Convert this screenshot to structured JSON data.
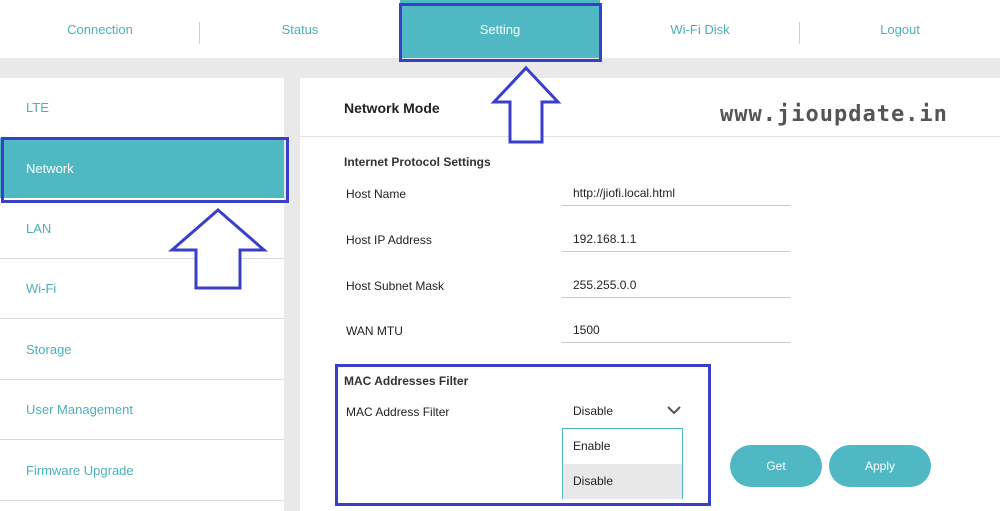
{
  "top_nav": {
    "tabs": [
      {
        "label": "Connection"
      },
      {
        "label": "Status"
      },
      {
        "label": "Setting"
      },
      {
        "label": "Wi-Fi  Disk"
      },
      {
        "label": "Logout"
      }
    ],
    "active_tab": "Setting"
  },
  "sidebar": {
    "items": [
      {
        "label": "LTE"
      },
      {
        "label": "Network"
      },
      {
        "label": "LAN"
      },
      {
        "label": "Wi-Fi"
      },
      {
        "label": "Storage"
      },
      {
        "label": "User  Management"
      },
      {
        "label": "Firmware  Upgrade"
      }
    ],
    "active_item": "Network"
  },
  "main": {
    "title": "Network  Mode",
    "watermark": "www.jioupdate.in",
    "internet_protocol": {
      "section_title": "Internet  Protocol  Settings",
      "fields": [
        {
          "label": "Host  Name",
          "value": "http://jiofi.local.html"
        },
        {
          "label": "Host  IP  Address",
          "value": "192.168.1.1"
        },
        {
          "label": "Host  Subnet  Mask",
          "value": "255.255.0.0"
        },
        {
          "label": "WAN  MTU",
          "value": "1500"
        }
      ]
    },
    "mac_filter": {
      "section_title": "MAC  Addresses  Filter",
      "label": "MAC  Address  Filter",
      "selected": "Disable",
      "options": [
        "Enable",
        "Disable"
      ]
    },
    "buttons": {
      "get": "Get",
      "apply": "Apply"
    }
  },
  "colors": {
    "accent": "#4fb8c2",
    "link_text": "#4ab0ba",
    "annotation_blue": "#3a3fc9",
    "background": "#e9e9e9"
  }
}
